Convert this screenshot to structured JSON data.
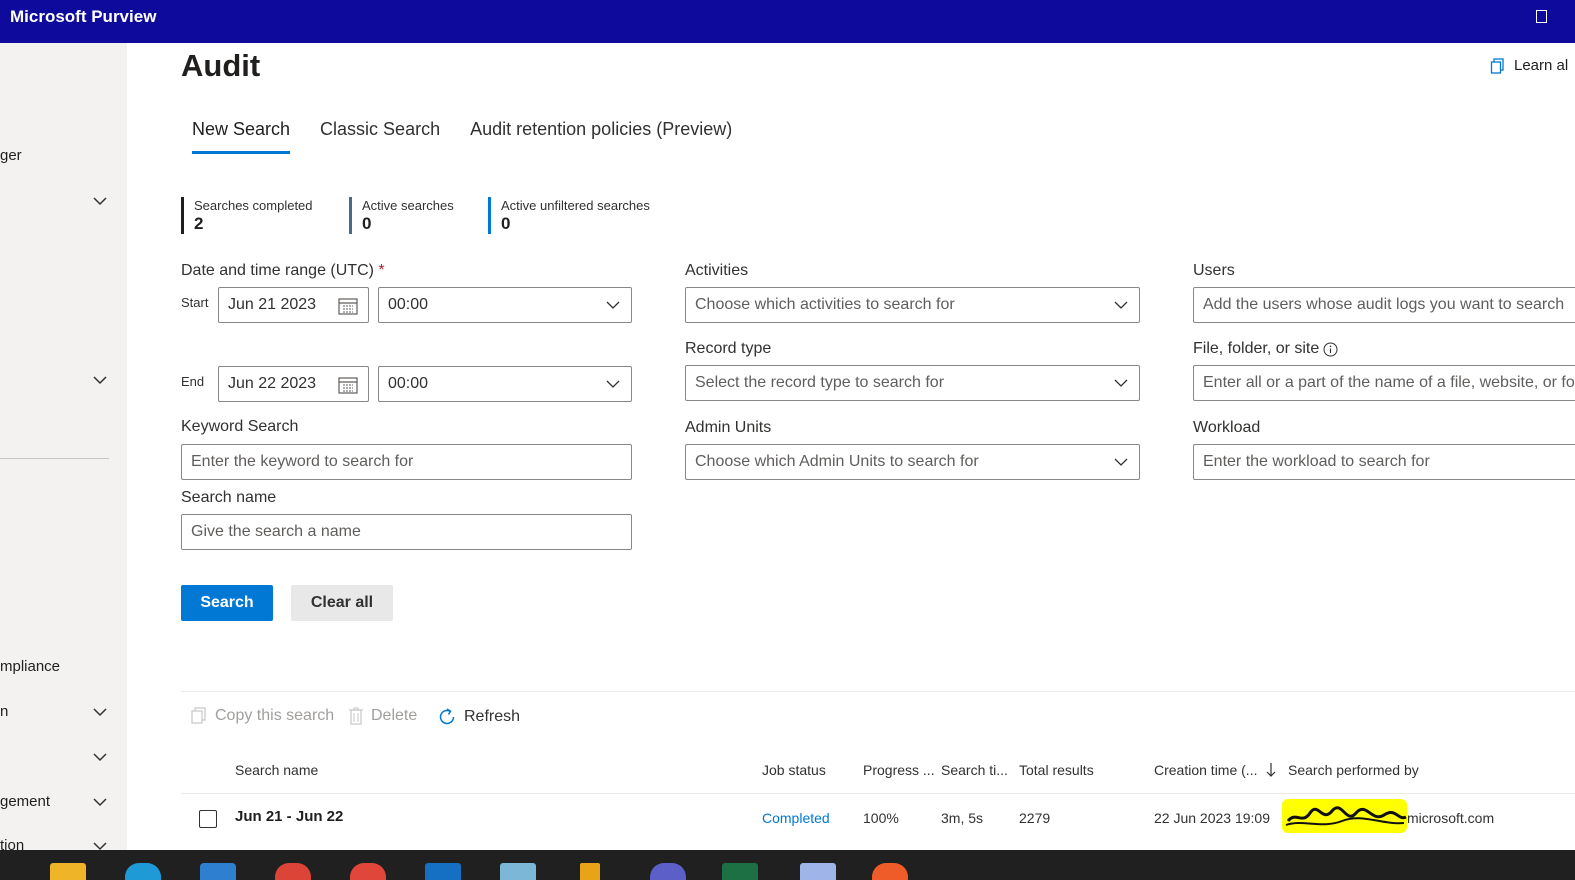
{
  "app": {
    "title": "Microsoft Purview"
  },
  "sidebar": {
    "items": [
      {
        "label": "ger"
      },
      {
        "label": "mpliance"
      },
      {
        "label": "n"
      },
      {
        "label": "gement"
      },
      {
        "label": "tion"
      }
    ]
  },
  "page": {
    "title": "Audit",
    "learn_label": "Learn al"
  },
  "tabs": [
    {
      "label": "New Search",
      "active": true
    },
    {
      "label": "Classic Search",
      "active": false
    },
    {
      "label": "Audit retention policies (Preview)",
      "active": false
    }
  ],
  "stats": [
    {
      "label": "Searches completed",
      "value": "2",
      "color": "#201f1e"
    },
    {
      "label": "Active searches",
      "value": "0",
      "color": "#4a6a8a"
    },
    {
      "label": "Active unfiltered searches",
      "value": "0",
      "color": "#0078d4"
    }
  ],
  "form": {
    "date_range_label": "Date and time range (UTC)",
    "required_mark": "*",
    "start_label": "Start",
    "start_date": "Jun 21 2023",
    "start_time": "00:00",
    "end_label": "End",
    "end_date": "Jun 22 2023",
    "end_time": "00:00",
    "keyword_label": "Keyword Search",
    "keyword_placeholder": "Enter the keyword to search for",
    "search_name_label": "Search name",
    "search_name_placeholder": "Give the search a name",
    "activities_label": "Activities",
    "activities_placeholder": "Choose which activities to search for",
    "record_type_label": "Record type",
    "record_type_placeholder": "Select the record type to search for",
    "admin_units_label": "Admin Units",
    "admin_units_placeholder": "Choose which Admin Units to search for",
    "users_label": "Users",
    "users_placeholder": "Add the users whose audit logs you want to search",
    "file_label": "File, folder, or site",
    "file_placeholder": "Enter all or a part of the name of a file, website, or fo",
    "workload_label": "Workload",
    "workload_placeholder": "Enter the workload to search for",
    "search_button": "Search",
    "clear_button": "Clear all"
  },
  "toolbar": {
    "copy_label": "Copy this search",
    "delete_label": "Delete",
    "refresh_label": "Refresh"
  },
  "table": {
    "columns": [
      "Search name",
      "Job status",
      "Progress ...",
      "Search ti...",
      "Total results",
      "Creation time (...",
      "Search performed by"
    ],
    "rows": [
      {
        "name": "Jun 21 - Jun 22",
        "status": "Completed",
        "progress": "100%",
        "search_time": "3m, 5s",
        "total_results": "2279",
        "creation_time": "22 Jun 2023 19:09",
        "performed_by": "microsoft.com"
      }
    ]
  },
  "colors": {
    "topbar": "#0e0b9c",
    "accent": "#0078d4",
    "redaction": "#ffff00"
  }
}
